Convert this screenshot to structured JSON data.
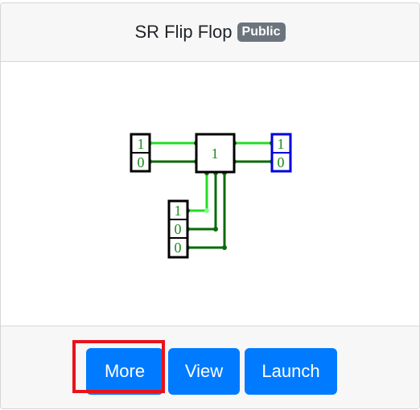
{
  "card": {
    "title": "SR Flip Flop",
    "badge": "Public"
  },
  "circuit": {
    "inputs_top": [
      "1",
      "0"
    ],
    "gate_label": "1",
    "outputs_top": [
      "1",
      "0"
    ],
    "inputs_bottom": [
      "1",
      "0",
      "0"
    ],
    "colors": {
      "wire_high": "#22dd22",
      "wire_low": "#0a6a0a",
      "output_border": "#0000dd",
      "text": "#1a8a1a"
    }
  },
  "footer": {
    "more_label": "More",
    "view_label": "View",
    "launch_label": "Launch"
  },
  "annotation": {
    "highlight_color": "#e8121b"
  }
}
